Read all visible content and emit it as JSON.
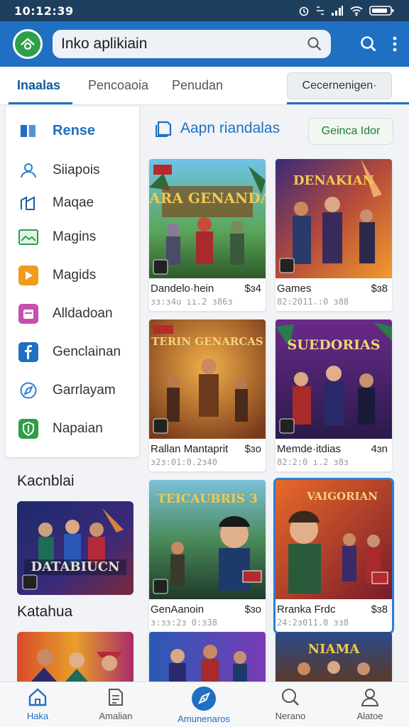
{
  "status_bar": {
    "time": "10:12:39"
  },
  "app_bar": {
    "search_value": "Inko aplikiain"
  },
  "tabs": [
    {
      "label": "Inaalas"
    },
    {
      "label": "Pencoaoia"
    },
    {
      "label": "Penudan"
    }
  ],
  "tab_button": {
    "label": "Cecernenigen·"
  },
  "sidebar": {
    "items": [
      {
        "label": "Rense",
        "icon": "book-icon"
      },
      {
        "label": "Siiapois",
        "icon": "person-icon"
      },
      {
        "label": "Maqae",
        "icon": "chart-icon"
      },
      {
        "label": "Magins",
        "icon": "landscape-icon"
      },
      {
        "label": "Magids",
        "icon": "play-icon"
      },
      {
        "label": "Alldadoan",
        "icon": "calendar-icon"
      },
      {
        "label": "Genclainan",
        "icon": "facebook-icon"
      },
      {
        "label": "Garrlayam",
        "icon": "compass-icon"
      },
      {
        "label": "Napaian",
        "icon": "shield-icon"
      }
    ]
  },
  "left_sections": [
    {
      "title": "Kacnblai",
      "banner_text": "DATABIUCN"
    },
    {
      "title": "Katahua"
    }
  ],
  "content": {
    "header": "Aapn riandalas",
    "chip": "Geinca Idor"
  },
  "cards": [
    {
      "title_art": "DIARA GENANDAN",
      "name": "Dandelo·hein",
      "price": "$ɜ4",
      "meta": "ɜɜ:ɜ4u ıı.2 ɜ86ɜ"
    },
    {
      "title_art": "DENAKIAN",
      "name": "Games",
      "price": "$ɜ8",
      "meta": "82:2011.:0 ɜ88"
    },
    {
      "title_art": "TERIN GENARCAS",
      "name": "Rallan Mantaprit",
      "price": "$ɜo",
      "meta": "ɜ2ɜ:01:0.2ɜ40"
    },
    {
      "title_art": "SUEDORIAS",
      "name": "Memde·itdias",
      "price": "4ɜn",
      "meta": "82:2:0 ı.2 ɜ8ɜ"
    },
    {
      "title_art": "TEICAUBRIS 3",
      "name": "GenAanoin",
      "price": "$ɜo",
      "meta": "ɜ:ɜɜ:2ɜ 0:ɜ38"
    },
    {
      "title_art": "VAIGORIAN",
      "name": "Rranka Frdc",
      "price": "$ɜ8",
      "meta": "24:2ɜ011.0 ɜɜ8"
    },
    {
      "title_art": "NIAMA",
      "name": "",
      "price": "",
      "meta": ""
    },
    {
      "title_art": "",
      "name": "",
      "price": "",
      "meta": ""
    }
  ],
  "bottom_nav": [
    {
      "label": "Haka",
      "icon": "home-icon"
    },
    {
      "label": "Amalian",
      "icon": "document-icon"
    },
    {
      "label": "Amunenaros",
      "icon": "compass-icon"
    },
    {
      "label": "Nerano",
      "icon": "search-icon"
    },
    {
      "label": "Alatoe",
      "icon": "user-icon"
    }
  ],
  "colors": {
    "status_bar": "#1f3f5f",
    "app_bar": "#1f6fc2",
    "accent": "#1f6fc2",
    "chip_text": "#1d7a3a"
  }
}
